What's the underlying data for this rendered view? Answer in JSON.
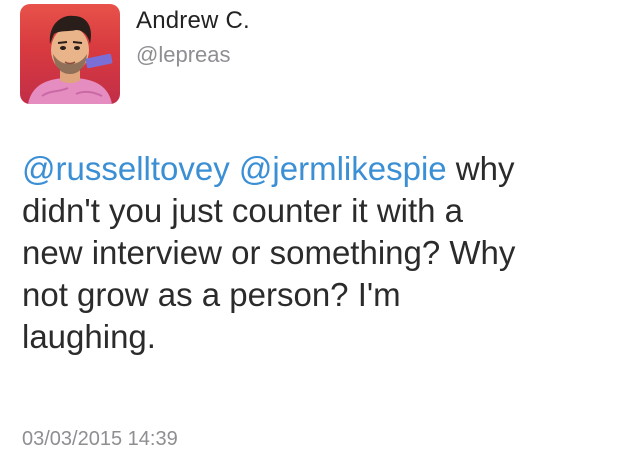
{
  "tweet": {
    "author_name": "Andrew C.",
    "author_handle": "@lepreas",
    "mention_1": "@russelltovey",
    "mention_2": "@jermlikespie",
    "text_line_1": " why",
    "text_line_2": "didn't you just counter it with a",
    "text_line_3": "new interview or something? Why",
    "text_line_4": "not grow as a person? I'm",
    "text_line_5": "laughing.",
    "timestamp": "03/03/2015 14:39"
  },
  "colors": {
    "mention": "#3b8fd4",
    "text": "#2b2b2b",
    "muted": "#8e8e93",
    "avatar_background": "#d83a3f"
  }
}
